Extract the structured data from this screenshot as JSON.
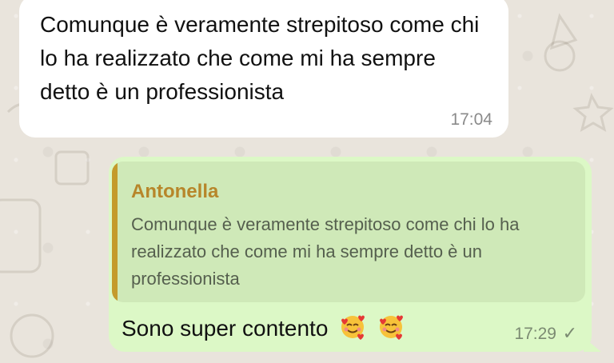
{
  "incoming_message": {
    "text": "Comunque è veramente strepitoso come chi lo ha realizzato che come mi ha sempre detto è un professionista",
    "time": "17:04"
  },
  "outgoing_message": {
    "quoted": {
      "author": "Antonella",
      "text": "Comunque è veramente strepitoso come chi lo ha realizzato che come mi ha sempre detto è un professionista"
    },
    "text": "Sono super contento",
    "emojis": [
      "smiling-face-with-hearts-icon",
      "smiling-face-with-hearts-icon"
    ],
    "time": "17:29",
    "status_icon": "single-check-icon"
  },
  "colors": {
    "wallpaper": "#e9e4dc",
    "incoming_bubble": "#ffffff",
    "outgoing_bubble": "#dcf8c6",
    "quote_bar": "#c49a2c",
    "quote_author": "#b7862a"
  }
}
